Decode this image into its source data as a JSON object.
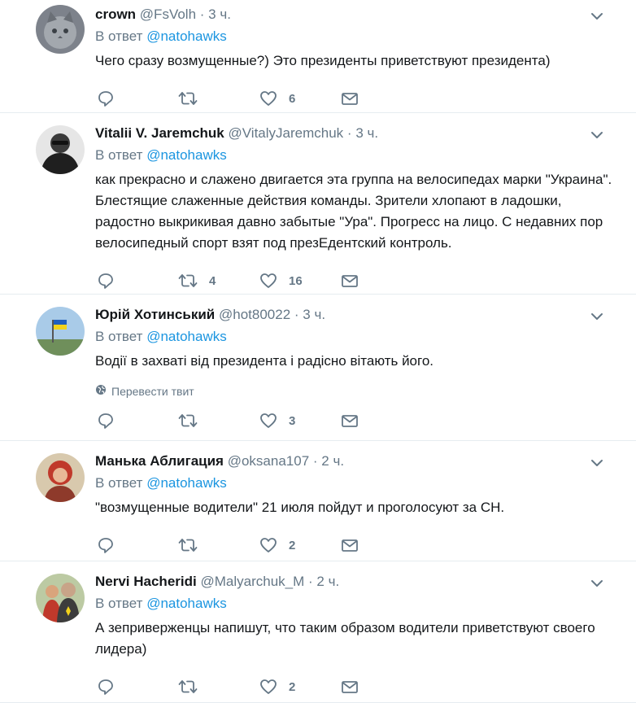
{
  "reply_prefix": "В ответ",
  "translate_label": "Перевести твит",
  "tweets": [
    {
      "name": "crown",
      "handle": "@FsVolh",
      "separator": "·",
      "time": "3 ч.",
      "reply_to": "@natohawks",
      "text": "Чего сразу возмущенные?) Это президенты приветствуют президента)",
      "replies": "",
      "retweets": "",
      "likes": "6",
      "avatar_icon": "cat-avatar",
      "avatar_colors": [
        "#8a8f99",
        "#5c6168"
      ]
    },
    {
      "name": "Vitalii V. Jaremchuk",
      "handle": "@VitalyJaremchuk",
      "separator": "·",
      "time": "3 ч.",
      "reply_to": "@natohawks",
      "text": "как прекрасно и слажено двигается эта группа на велосипедах марки \"Украина\". Блестящие слаженные действия команды. Зрители хлопают в ладошки, радостно выкрикивая давно забытые \"Ура\". Прогресс на лицо. С недавних пор велосипедный спорт  взят под презЕдентский контроль.",
      "replies": "",
      "retweets": "4",
      "likes": "16",
      "avatar_icon": "person-sunglasses-avatar",
      "avatar_colors": [
        "#e9e9e9",
        "#2a2a2a"
      ]
    },
    {
      "name": "Юрій Хотинський",
      "handle": "@hot80022",
      "separator": "·",
      "time": "3 ч.",
      "reply_to": "@natohawks",
      "text": "Водії в захваті від президента і радісно вітають його.",
      "translate": true,
      "replies": "",
      "retweets": "",
      "likes": "3",
      "avatar_icon": "flag-sky-avatar",
      "avatar_colors": [
        "#9cc3e6",
        "#6b8a5a"
      ]
    },
    {
      "name": "Манька Аблигация",
      "handle": "@oksana107",
      "separator": "·",
      "time": "2 ч.",
      "reply_to": "@natohawks",
      "text": "\"возмущенные водители\" 21 июля пойдут и проголосуют за СН.",
      "replies": "",
      "retweets": "",
      "likes": "2",
      "avatar_icon": "woman-red-hair-avatar",
      "avatar_colors": [
        "#d9c9b0",
        "#c0392b"
      ]
    },
    {
      "name": "Nervi Hacheridi",
      "handle": "@Malyarchuk_M",
      "separator": "·",
      "time": "2 ч.",
      "reply_to": "@natohawks",
      "text": "А зеприверженцы напишут, что таким образом водители приветствуют своего лидера)",
      "replies": "",
      "retweets": "",
      "likes": "2",
      "avatar_icon": "group-photo-avatar",
      "avatar_colors": [
        "#b8c7a0",
        "#444444"
      ]
    }
  ]
}
